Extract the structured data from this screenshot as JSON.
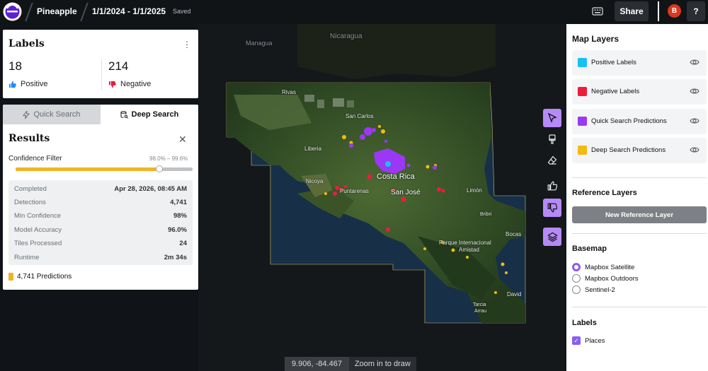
{
  "header": {
    "project_name": "Pineapple",
    "date_range": "1/1/2024 - 1/1/2025",
    "status": "Saved",
    "share_label": "Share",
    "avatar_initial": "B",
    "help_label": "?"
  },
  "labels_card": {
    "title": "Labels",
    "positive_count": "18",
    "positive_label": "Positive",
    "negative_count": "214",
    "negative_label": "Negative"
  },
  "search": {
    "tabs": [
      {
        "label": "Quick Search",
        "active": false
      },
      {
        "label": "Deep Search",
        "active": true
      }
    ],
    "results_title": "Results",
    "confidence_filter_label": "Confidence Filter",
    "confidence_range": "98.0% – 99.6%",
    "slider_fraction": 0.81,
    "stats": [
      {
        "label": "Completed",
        "value": "Apr 28, 2026, 08:45 AM"
      },
      {
        "label": "Detections",
        "value": "4,741"
      },
      {
        "label": "Min Confidence",
        "value": "98%"
      },
      {
        "label": "Model Accuracy",
        "value": "96.0%"
      },
      {
        "label": "Tiles Processed",
        "value": "24"
      },
      {
        "label": "Runtime",
        "value": "2m 34s"
      }
    ],
    "predictions_summary": "4,741 Predictions"
  },
  "map": {
    "labels": {
      "nicaragua": "Nicaragua",
      "managua": "Managua",
      "rivas": "Rivas",
      "san_carlos": "San Carlos",
      "liberia": "Liberia",
      "nicoya": "Nicoya",
      "puntarenas": "Puntarenas",
      "costa_rica": "Costa Rica",
      "san_jose": "San José",
      "limon": "Limón",
      "bribri": "Bribri",
      "bocas": "Bocas",
      "parque": "Parque Internacional",
      "amistad": "Amistad",
      "david": "David",
      "arrau": "Arrau",
      "tarcia": "Tarcia"
    },
    "coordinates": "9.906, -84.467",
    "zoom_hint": "Zoom in to draw"
  },
  "tools": [
    {
      "icon": "cursor-icon",
      "active": true
    },
    {
      "icon": "brush-icon",
      "active": false
    },
    {
      "icon": "eraser-icon",
      "active": false
    },
    {
      "icon": "thumbs-up-icon",
      "active": false
    },
    {
      "icon": "thumbs-down-icon",
      "active": true
    },
    {
      "icon": "layers-icon",
      "active": true
    }
  ],
  "right_panel": {
    "map_layers_title": "Map Layers",
    "layers": [
      {
        "name": "Positive Labels",
        "color": "#16c1f3"
      },
      {
        "name": "Negative Labels",
        "color": "#ef1c3a"
      },
      {
        "name": "Quick Search Predictions",
        "color": "#9b38f5"
      },
      {
        "name": "Deep Search Predictions",
        "color": "#f5b90f"
      }
    ],
    "reference_title": "Reference Layers",
    "new_reference_label": "New Reference Layer",
    "basemap_title": "Basemap",
    "basemaps": [
      {
        "label": "Mapbox Satellite",
        "selected": true
      },
      {
        "label": "Mapbox Outdoors",
        "selected": false
      },
      {
        "label": "Sentinel-2",
        "selected": false
      }
    ],
    "labels_title": "Labels",
    "places_label": "Places",
    "places_checked": true
  },
  "colors": {
    "accent": "#8b5cf6",
    "positive": "#16c1f3",
    "negative": "#ef1c3a",
    "deep_prediction": "#f5b90f",
    "quick_prediction": "#9b38f5"
  }
}
